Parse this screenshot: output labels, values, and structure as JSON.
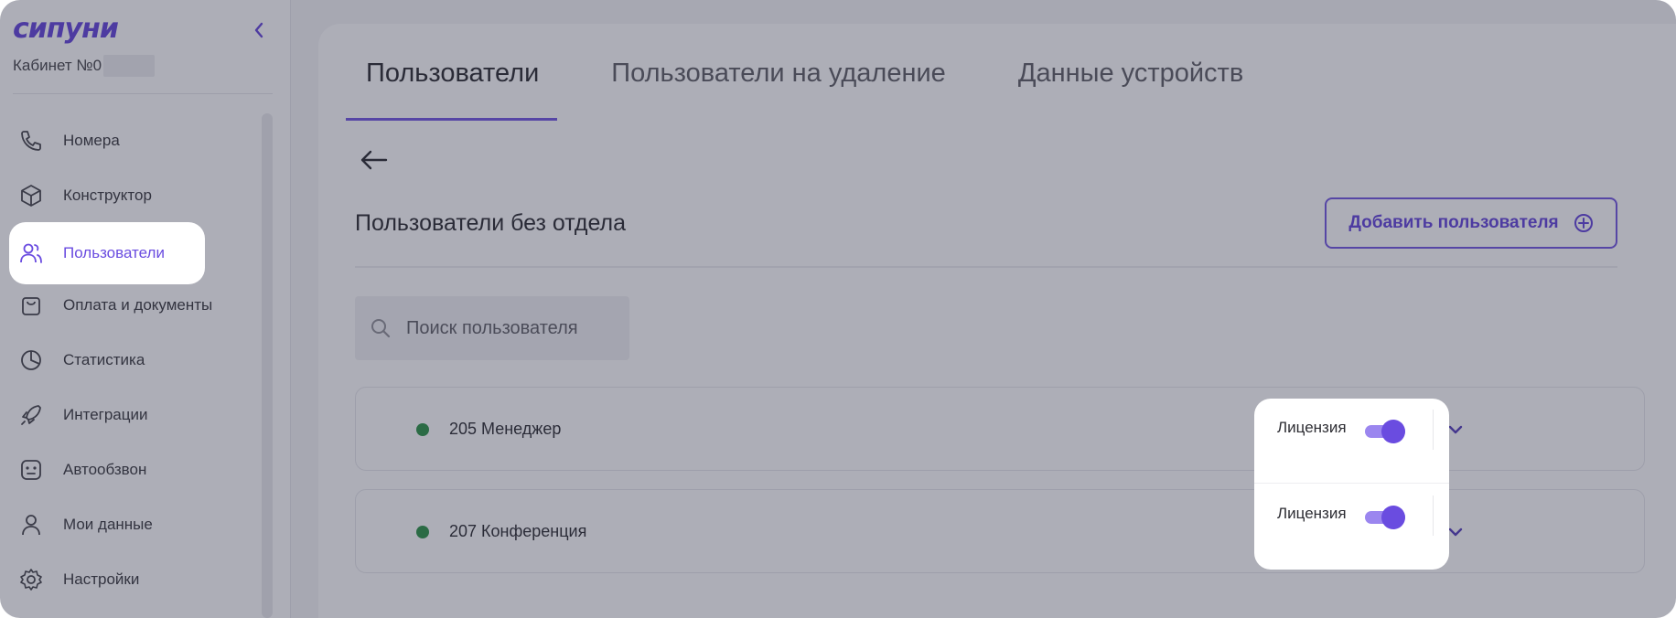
{
  "brand": {
    "logo_text": "сипуни",
    "accent": "#6a4ce0"
  },
  "sidebar": {
    "cabinet_label": "Кабинет №0",
    "items": [
      {
        "label": "Номера",
        "icon": "phone-icon"
      },
      {
        "label": "Конструктор",
        "icon": "cube-icon"
      },
      {
        "label": "Пользователи",
        "icon": "users-icon",
        "active": true
      },
      {
        "label": "Оплата и документы",
        "icon": "bag-icon"
      },
      {
        "label": "Статистика",
        "icon": "pie-chart-icon"
      },
      {
        "label": "Интеграции",
        "icon": "rocket-icon"
      },
      {
        "label": "Автообзвон",
        "icon": "robot-icon"
      },
      {
        "label": "Мои данные",
        "icon": "person-icon"
      },
      {
        "label": "Настройки",
        "icon": "gear-icon"
      }
    ]
  },
  "tabs": [
    {
      "label": "Пользователи",
      "active": true
    },
    {
      "label": "Пользователи на удаление",
      "active": false
    },
    {
      "label": "Данные устройств",
      "active": false
    }
  ],
  "section": {
    "title": "Пользователи без отдела",
    "add_button": "Добавить пользователя",
    "search_placeholder": "Поиск пользователя"
  },
  "users": [
    {
      "name": "205 Менеджер",
      "status": "online",
      "license_label": "Лицензия",
      "license_on": true
    },
    {
      "name": "207 Конференция",
      "status": "online",
      "license_label": "Лицензия",
      "license_on": true
    }
  ]
}
